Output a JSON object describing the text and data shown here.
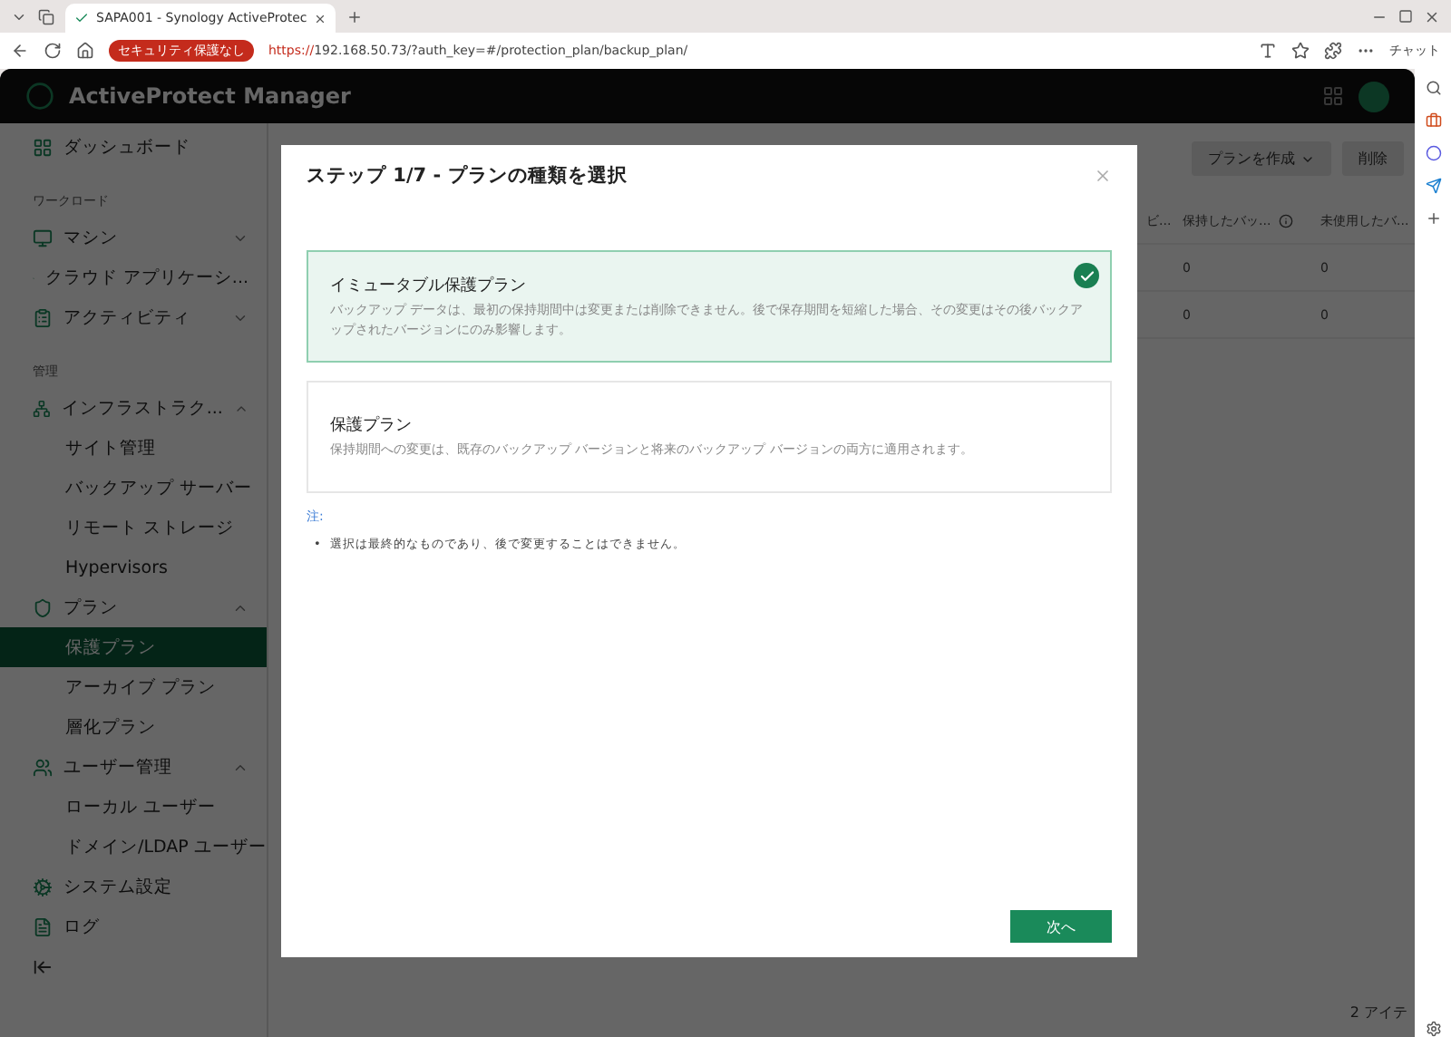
{
  "browser": {
    "tab_title": "SAPA001 - Synology ActiveProtec",
    "security_badge": "セキュリティ保護なし",
    "url_scheme": "https://",
    "url_rest": "192.168.50.73/?auth_key=#/protection_plan/backup_plan/",
    "copilot_label": "チャット"
  },
  "app": {
    "title": "ActiveProtect Manager"
  },
  "sidebar": {
    "items": [
      {
        "kind": "item",
        "label": "ダッシュボード",
        "selected": false
      },
      {
        "kind": "section",
        "label": "ワークロード"
      },
      {
        "kind": "item",
        "label": "マシン",
        "selected": false,
        "expanded": false
      },
      {
        "kind": "item",
        "label": "クラウド アプリケーシ...",
        "selected": false
      },
      {
        "kind": "item",
        "label": "アクティビティ",
        "selected": false,
        "expanded": false
      },
      {
        "kind": "section",
        "label": "管理"
      },
      {
        "kind": "item",
        "label": "インフラストラク...",
        "selected": false,
        "expanded": true
      },
      {
        "kind": "sub",
        "label": "サイト管理",
        "selected": false
      },
      {
        "kind": "sub",
        "label": "バックアップ サーバー",
        "selected": false
      },
      {
        "kind": "sub",
        "label": "リモート ストレージ",
        "selected": false
      },
      {
        "kind": "sub",
        "label": "Hypervisors",
        "selected": false
      },
      {
        "kind": "item",
        "label": "プラン",
        "selected": false,
        "expanded": true
      },
      {
        "kind": "sub",
        "label": "保護プラン",
        "selected": true
      },
      {
        "kind": "sub",
        "label": "アーカイブ プラン",
        "selected": false
      },
      {
        "kind": "sub",
        "label": "層化プラン",
        "selected": false
      },
      {
        "kind": "item",
        "label": "ユーザー管理",
        "selected": false,
        "expanded": true
      },
      {
        "kind": "sub",
        "label": "ローカル ユーザー",
        "selected": false
      },
      {
        "kind": "sub",
        "label": "ドメイン/LDAP ユーザー",
        "selected": false
      },
      {
        "kind": "item",
        "label": "システム設定",
        "selected": false
      },
      {
        "kind": "item",
        "label": "ログ",
        "selected": false
      }
    ]
  },
  "toolbar": {
    "create_button": "プランを作成",
    "delete_button": "削除"
  },
  "table": {
    "columns": [
      "ビ...",
      "保持したバッ...",
      "未使用したバ..."
    ],
    "rows": [
      [
        "",
        "0",
        "0"
      ],
      [
        "",
        "0",
        "0"
      ]
    ]
  },
  "footer": {
    "item_count": "2 アイテ"
  },
  "modal": {
    "title": "ステップ 1/7 - プランの種類を選択",
    "options": [
      {
        "title": "イミュータブル保護プラン",
        "description": "バックアップ データは、最初の保持期間中は変更または削除できません。後で保存期間を短縮した場合、その変更はその後バックアップされたバージョンにのみ影響します。",
        "selected": true
      },
      {
        "title": "保護プラン",
        "description": "保持期間への変更は、既存のバックアップ バージョンと将来のバックアップ バージョンの両方に適用されます。",
        "selected": false
      }
    ],
    "note_label": "注:",
    "note_marker": "•",
    "notes": [
      "選択は最終的なものであり、後で変更することはできません。"
    ],
    "next_button": "次へ"
  }
}
